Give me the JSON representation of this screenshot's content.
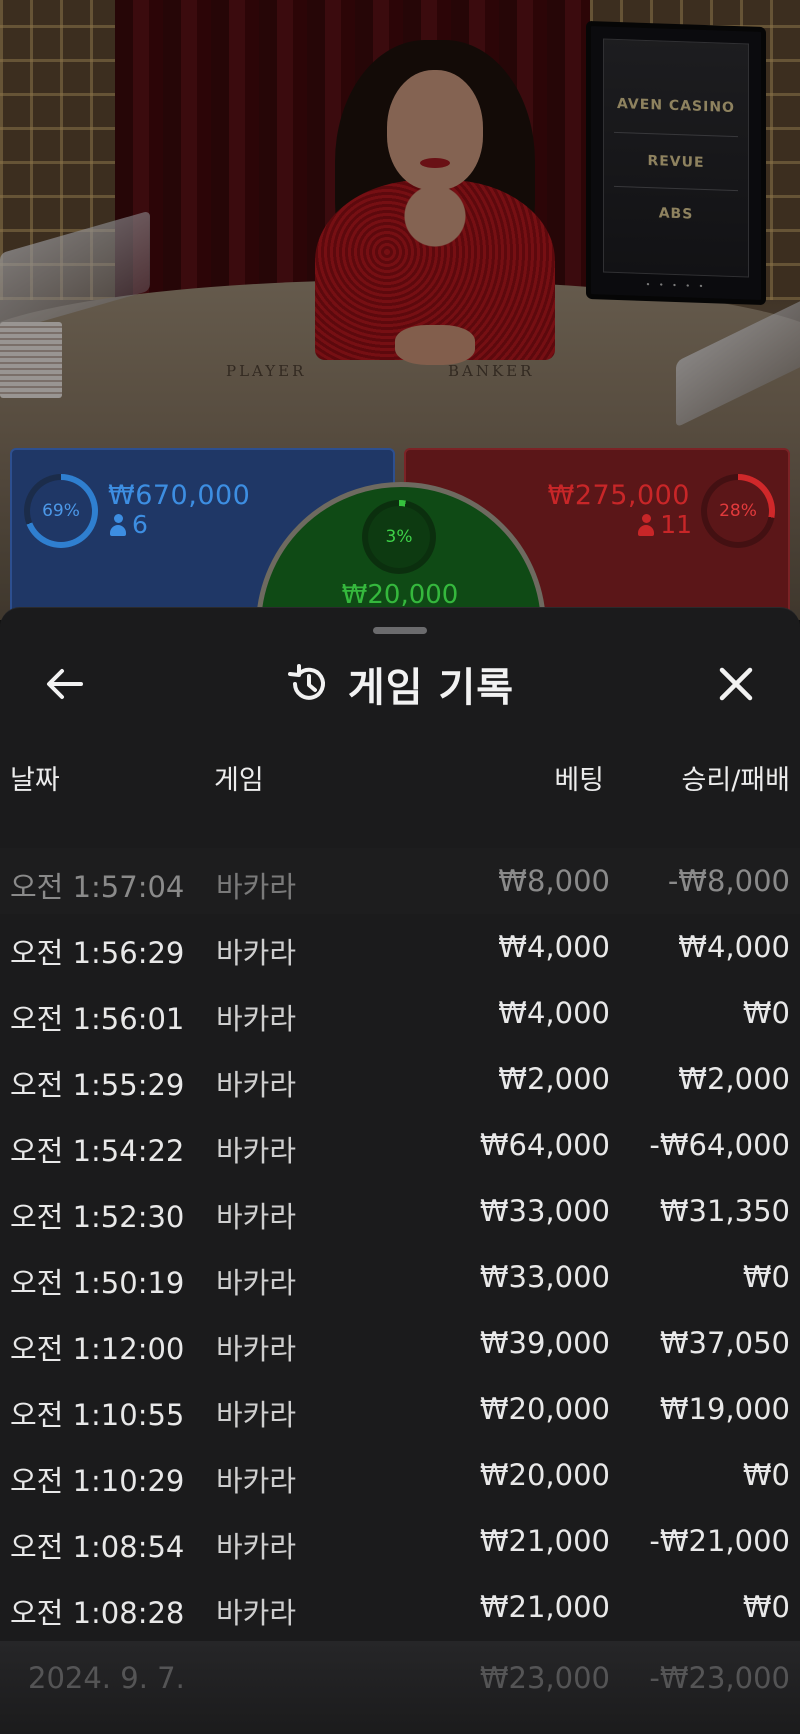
{
  "video": {
    "felt_labels": [
      "PLAYER",
      "BANKER"
    ],
    "screen_logos": [
      "AVEN CASINO",
      "REVUE",
      "ABS"
    ]
  },
  "bets": {
    "player": {
      "percent": "69%",
      "percent_value": 0.69,
      "amount": "₩670,000",
      "count": "6",
      "color": "#3d8ee2"
    },
    "banker": {
      "percent": "28%",
      "percent_value": 0.28,
      "amount": "₩275,000",
      "count": "11",
      "color": "#c82628"
    },
    "tie": {
      "percent": "3%",
      "percent_value": 0.03,
      "amount": "₩20,000",
      "color": "#35b83d"
    }
  },
  "history": {
    "title": "게임 기록",
    "icons": {
      "back": "arrow-left-icon",
      "title": "history-icon",
      "close": "close-icon"
    },
    "columns": {
      "date": "날짜",
      "game": "게임",
      "bet": "베팅",
      "win_loss": "승리/패배"
    },
    "rows": [
      {
        "date": "오전 1:57:04",
        "game": "바카라",
        "bet": "₩8,000",
        "win_loss": "-₩8,000"
      },
      {
        "date": "오전 1:56:29",
        "game": "바카라",
        "bet": "₩4,000",
        "win_loss": "₩4,000"
      },
      {
        "date": "오전 1:56:01",
        "game": "바카라",
        "bet": "₩4,000",
        "win_loss": "₩0"
      },
      {
        "date": "오전 1:55:29",
        "game": "바카라",
        "bet": "₩2,000",
        "win_loss": "₩2,000"
      },
      {
        "date": "오전 1:54:22",
        "game": "바카라",
        "bet": "₩64,000",
        "win_loss": "-₩64,000"
      },
      {
        "date": "오전 1:52:30",
        "game": "바카라",
        "bet": "₩33,000",
        "win_loss": "₩31,350"
      },
      {
        "date": "오전 1:50:19",
        "game": "바카라",
        "bet": "₩33,000",
        "win_loss": "₩0"
      },
      {
        "date": "오전 1:12:00",
        "game": "바카라",
        "bet": "₩39,000",
        "win_loss": "₩37,050"
      },
      {
        "date": "오전 1:10:55",
        "game": "바카라",
        "bet": "₩20,000",
        "win_loss": "₩19,000"
      },
      {
        "date": "오전 1:10:29",
        "game": "바카라",
        "bet": "₩20,000",
        "win_loss": "₩0"
      },
      {
        "date": "오전 1:08:54",
        "game": "바카라",
        "bet": "₩21,000",
        "win_loss": "-₩21,000"
      },
      {
        "date": "오전 1:08:28",
        "game": "바카라",
        "bet": "₩21,000",
        "win_loss": "₩0"
      }
    ],
    "partial_row": {
      "date": "2024. 9. 7.",
      "bet": "₩23,000",
      "win_loss": "-₩23,000"
    }
  }
}
